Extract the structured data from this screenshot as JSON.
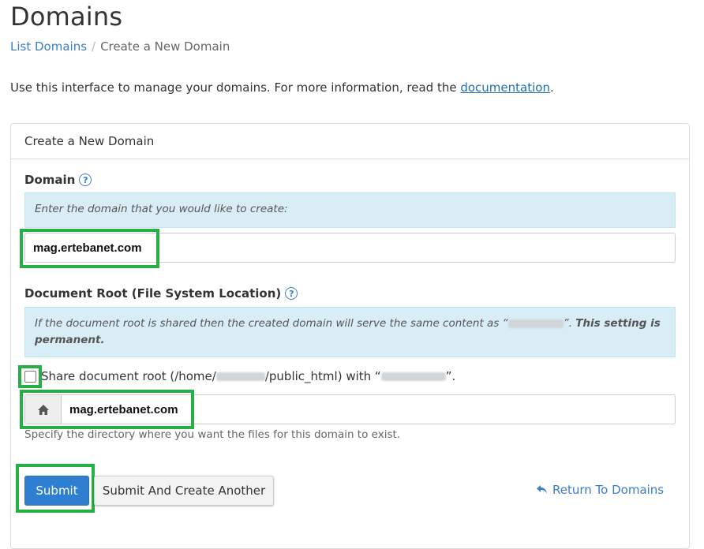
{
  "header": {
    "title": "Domains"
  },
  "breadcrumb": {
    "items": [
      "List Domains",
      "Create a New Domain"
    ],
    "separator": "/"
  },
  "intro": {
    "text": "Use this interface to manage your domains. For more information, read the ",
    "link": "documentation",
    "suffix": "."
  },
  "panel": {
    "heading": "Create a New Domain"
  },
  "domain": {
    "label": "Domain",
    "help_icon": "?",
    "info": "Enter the domain that you would like to create:",
    "value": "mag.ertebanet.com"
  },
  "docroot": {
    "label": "Document Root (File System Location)",
    "help_icon": "?",
    "info_prefix": "If the document root is shared then the created domain will serve the same content as “",
    "info_mid": "”. ",
    "info_strong": "This setting is permanent.",
    "share_prefix": "Share document root (/home/",
    "share_mid": "/public_html) with “",
    "share_suffix": "”.",
    "share_checked": false,
    "value": "mag.ertebanet.com",
    "help": "Specify the directory where you want the files for this domain to exist."
  },
  "actions": {
    "submit": "Submit",
    "submit_another": "Submit And Create Another",
    "return": "Return To Domains"
  },
  "colors": {
    "primary": "#2e7fd1",
    "link": "#3b7fc4",
    "highlight": "#27ae45",
    "info_bg": "#d9edf7"
  }
}
